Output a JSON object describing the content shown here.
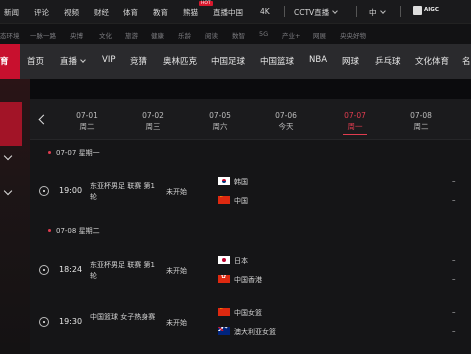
{
  "topnav": {
    "items": [
      "新闻",
      "评论",
      "视频",
      "财经",
      "体育",
      "教育",
      "熊猫",
      "直播中国",
      "4K"
    ],
    "hot_badge": "HOT",
    "cctv_live": "CCTV直播",
    "language": "中",
    "aibc_label": "AIGC"
  },
  "subnav": {
    "items": [
      "态环境",
      "一脉一路",
      "央博",
      "文化",
      "旅游",
      "健康",
      "乐龄",
      "阅读",
      "数智",
      "5G",
      "产业+",
      "网展",
      "央央好物"
    ]
  },
  "sportnav": {
    "logo_text": "育",
    "items": [
      "首页",
      "直播",
      "VIP",
      "竞猜",
      "奥林匹克",
      "中国足球",
      "中国篮球",
      "NBA",
      "网球",
      "乒乓球",
      "文化体育",
      "名"
    ]
  },
  "schedule": {
    "dates": [
      {
        "date": "07-01",
        "day": "周二"
      },
      {
        "date": "07-02",
        "day": "周三"
      },
      {
        "date": "07-05",
        "day": "周六"
      },
      {
        "date": "07-06",
        "day": "今天"
      },
      {
        "date": "07-07",
        "day": "周一"
      },
      {
        "date": "07-08",
        "day": "周二"
      }
    ],
    "active_index": 4,
    "day_headers": [
      "07-07 星期一",
      "07-08 星期二"
    ],
    "matches": [
      {
        "time": "19:00",
        "title": "东亚杯男足 联赛 第1轮",
        "status": "未开始",
        "team1": "韩国",
        "team2": "中国",
        "flag1": "kr",
        "flag2": "cn",
        "dash": "–"
      },
      {
        "time": "18:24",
        "title": "东亚杯男足 联赛 第1轮",
        "status": "未开始",
        "team1": "日本",
        "team2": "中国香港",
        "flag1": "jp",
        "flag2": "hk",
        "dash": "–"
      },
      {
        "time": "19:30",
        "title": "中国篮球 女子热身赛",
        "status": "未开始",
        "team1": "中国女篮",
        "team2": "澳大利亚女篮",
        "flag1": "cn",
        "flag2": "au",
        "dash": "–"
      }
    ]
  }
}
